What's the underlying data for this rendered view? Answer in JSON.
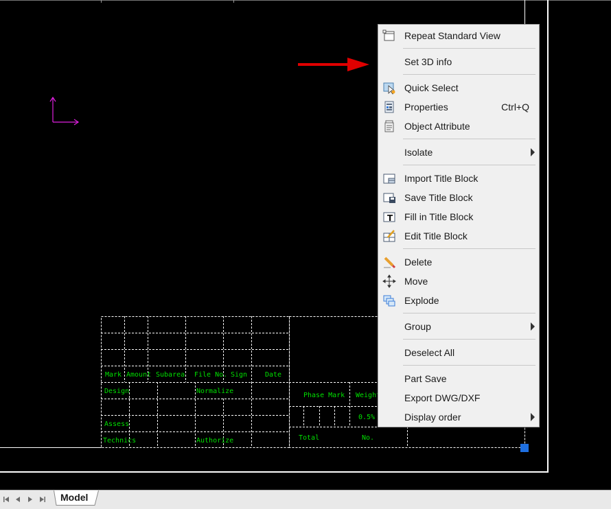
{
  "context_menu": {
    "items": [
      {
        "label": "Repeat Standard View",
        "icon": "standard-view-icon"
      },
      {
        "label": "Set 3D info",
        "icon": ""
      },
      {
        "label": "Quick Select",
        "icon": "quick-select-icon"
      },
      {
        "label": "Properties",
        "shortcut": "Ctrl+Q",
        "icon": "properties-icon"
      },
      {
        "label": "Object Attribute",
        "icon": "object-attribute-icon"
      },
      {
        "label": "Isolate",
        "icon": "",
        "submenu": true
      },
      {
        "label": "Import Title Block",
        "icon": "import-title-block-icon"
      },
      {
        "label": "Save Title Block",
        "icon": "save-title-block-icon"
      },
      {
        "label": "Fill in Title Block",
        "icon": "fill-title-block-icon"
      },
      {
        "label": "Edit Title Block",
        "icon": "edit-title-block-icon"
      },
      {
        "label": "Delete",
        "icon": "delete-icon"
      },
      {
        "label": "Move",
        "icon": "move-icon"
      },
      {
        "label": "Explode",
        "icon": "explode-icon"
      },
      {
        "label": "Group",
        "icon": "",
        "submenu": true
      },
      {
        "label": "Deselect All",
        "icon": ""
      },
      {
        "label": "Part Save",
        "icon": ""
      },
      {
        "label": "Export DWG/DXF",
        "icon": ""
      },
      {
        "label": "Display order",
        "icon": "",
        "submenu": true
      }
    ]
  },
  "title_block": {
    "labels": {
      "mark": "Mark",
      "amount": "Amount",
      "subarea": "Subarea",
      "file_no": "File No.",
      "sign": "Sign",
      "date": "Date",
      "design": "Design",
      "normalize": "Normalize",
      "assess": "Assess",
      "technics": "Technics",
      "authorize": "Authorize",
      "phase_mark": "Phase Mark",
      "weight": "Weight",
      "scale": "0.5%",
      "total": "Total",
      "no": "No."
    }
  },
  "tabs": {
    "active": "Model"
  },
  "colors": {
    "canvas_bg": "#000000",
    "title_block_text": "#00e000",
    "ucs_icon": "#e020e0",
    "annotation_arrow": "#e00000",
    "grip": "#1e6fe0"
  }
}
